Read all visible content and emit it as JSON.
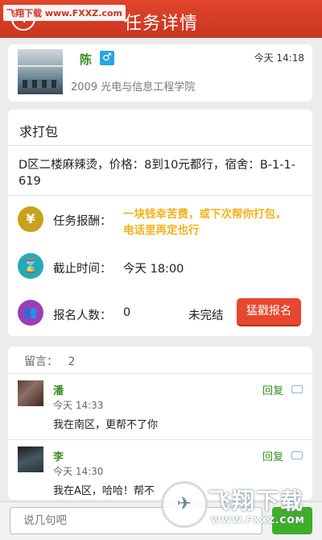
{
  "header": {
    "title": "任务详情",
    "back_icon": "‹",
    "watermark": "飞翔下载 www.FXXZ.com"
  },
  "poster": {
    "name": "陈",
    "gender_icon": "♂",
    "time": "今天 14:18",
    "info": "2009 光电与信息工程学院"
  },
  "task": {
    "title": "求打包",
    "description": "D区二楼麻辣烫，价格：8到10元都行，宿舍：B-1-1-619",
    "reward_label": "任务报酬：",
    "reward_value": "一块钱幸苦费，或下次帮你打包，电话里再定也行",
    "deadline_label": "截止时间：",
    "deadline_value": "今天 18:00",
    "applicants_label": "报名人数：",
    "applicants_value": "0",
    "status": "未完结",
    "signup_button": "猛戳报名",
    "icons": {
      "reward": "¥",
      "deadline": "⌛",
      "applicants": "👥"
    },
    "colors": {
      "reward_icon": "#c8a21a",
      "deadline_icon": "#27a9b8",
      "applicants_icon": "#9b3fb5",
      "reward_text": "#f5b11a"
    }
  },
  "comments": {
    "label": "留言：",
    "count": "2",
    "items": [
      {
        "name": "潘",
        "time": "今天 14:33",
        "text": "我在南区，更帮不了你",
        "reply": "回复"
      },
      {
        "name": "李",
        "time": "今天 14:30",
        "text": "我在A区，哈哈！帮不",
        "reply": "回复"
      }
    ]
  },
  "input": {
    "placeholder": "说几句吧"
  },
  "watermark": {
    "brand": "飞翔下载",
    "url": "WWW.FXXZ.COM"
  }
}
